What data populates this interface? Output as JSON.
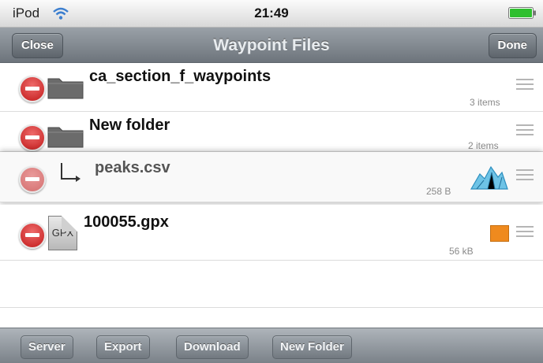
{
  "status_bar": {
    "carrier": "iPod",
    "time": "21:49",
    "wifi_icon": "wifi-icon",
    "battery_icon": "battery-full-icon",
    "battery_color": "#2fbf2f",
    "battery_level": 1.0
  },
  "nav_bar": {
    "title": "Waypoint Files",
    "left_button": "Close",
    "right_button": "Done"
  },
  "files": [
    {
      "name": "ca_section_f_waypoints",
      "meta": "3 items",
      "icon": "folder-icon"
    },
    {
      "name": "New folder",
      "meta": "2 items",
      "icon": "folder-icon"
    },
    {
      "name": "peaks.csv",
      "meta": "258 B",
      "icon": "arrow-icon",
      "badge": "mountain-icon"
    },
    {
      "name": "100055.gpx",
      "meta": "56 kB",
      "icon": "gpx-file-icon",
      "file_badge": "GPX",
      "badge_color": "#ef8a1e"
    }
  ],
  "toolbar": {
    "server": "Server",
    "export": "Export",
    "download": "Download",
    "new_folder": "New Folder"
  },
  "colors": {
    "nav_bar": "#7d848b",
    "delete": "#c21a1a"
  }
}
